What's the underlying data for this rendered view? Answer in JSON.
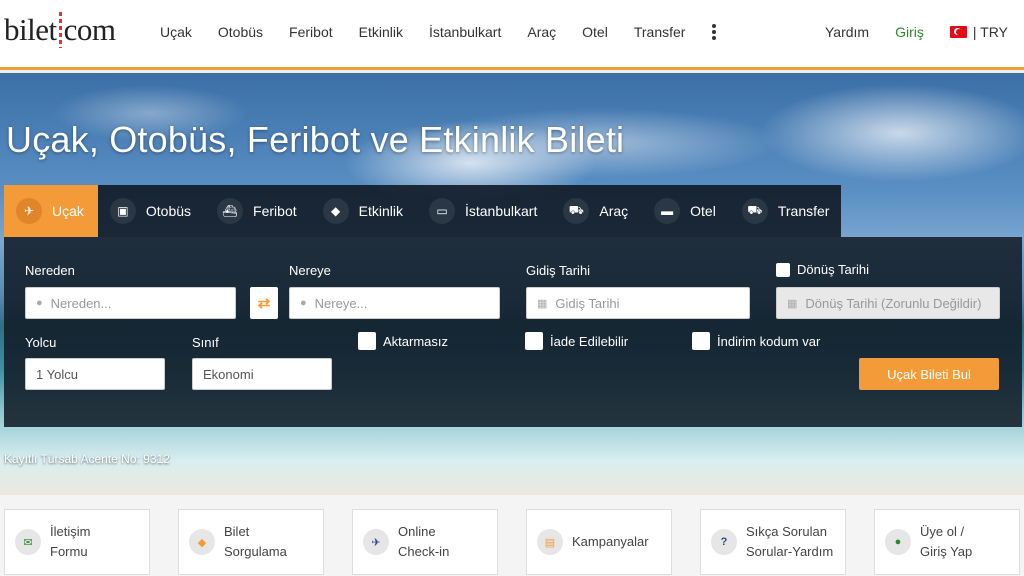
{
  "header": {
    "logo_left": "bilet",
    "logo_right": "com",
    "nav": [
      "Uçak",
      "Otobüs",
      "Feribot",
      "Etkinlik",
      "İstanbulkart",
      "Araç",
      "Otel",
      "Transfer"
    ],
    "help": "Yardım",
    "login": "Giriş",
    "currency": "| TRY"
  },
  "hero": {
    "title": "Uçak, Otobüs, Feribot ve Etkinlik Bileti",
    "tursab": "Kayıtlı Türsab Acente No: 9312"
  },
  "tabs": [
    {
      "label": "Uçak",
      "icon": "plane-icon",
      "glyph": "✈"
    },
    {
      "label": "Otobüs",
      "icon": "bus-icon",
      "glyph": "▣"
    },
    {
      "label": "Feribot",
      "icon": "ferry-icon",
      "glyph": "⛴"
    },
    {
      "label": "Etkinlik",
      "icon": "ticket-icon",
      "glyph": "◆"
    },
    {
      "label": "İstanbulkart",
      "icon": "card-icon",
      "glyph": "▭"
    },
    {
      "label": "Araç",
      "icon": "car-icon",
      "glyph": "⛟"
    },
    {
      "label": "Otel",
      "icon": "bed-icon",
      "glyph": "▬"
    },
    {
      "label": "Transfer",
      "icon": "taxi-icon",
      "glyph": "⛟"
    }
  ],
  "form": {
    "from_label": "Nereden",
    "from_placeholder": "Nereden...",
    "to_label": "Nereye",
    "to_placeholder": "Nereye...",
    "depart_label": "Gidiş Tarihi",
    "depart_placeholder": "Gidiş Tarihi",
    "return_label": "Dönüş Tarihi",
    "return_placeholder": "Dönüş Tarihi (Zorunlu Değildir)",
    "passenger_label": "Yolcu",
    "passenger_value": "1 Yolcu",
    "class_label": "Sınıf",
    "class_value": "Ekonomi",
    "nonstop": "Aktarmasız",
    "refundable": "İade Edilebilir",
    "discount": "İndirim kodum var",
    "search_button": "Uçak Bileti Bul"
  },
  "quick_links": [
    {
      "label": "İletişim\nFormu",
      "icon": "envelope-icon",
      "glyph": "✉",
      "color": "#2a8a2a"
    },
    {
      "label": "Bilet\nSorgulama",
      "icon": "ticket-icon",
      "glyph": "◆",
      "color": "#f29b38"
    },
    {
      "label": "Online\nCheck-in",
      "icon": "plane-icon",
      "glyph": "✈",
      "color": "#2a4a8a"
    },
    {
      "label": "Kampanyalar",
      "icon": "campaign-icon",
      "glyph": "▤",
      "color": "#f29b38"
    },
    {
      "label": "Sıkça Sorulan\nSorular-Yardım",
      "icon": "question-icon",
      "glyph": "?",
      "color": "#2a4a8a"
    },
    {
      "label": "Üye ol /\nGiriş Yap",
      "icon": "user-icon",
      "glyph": "●",
      "color": "#2a8a2a"
    }
  ],
  "colors": {
    "accent": "#f29b38",
    "login": "#2a8a2a",
    "panel": "#121c28"
  }
}
